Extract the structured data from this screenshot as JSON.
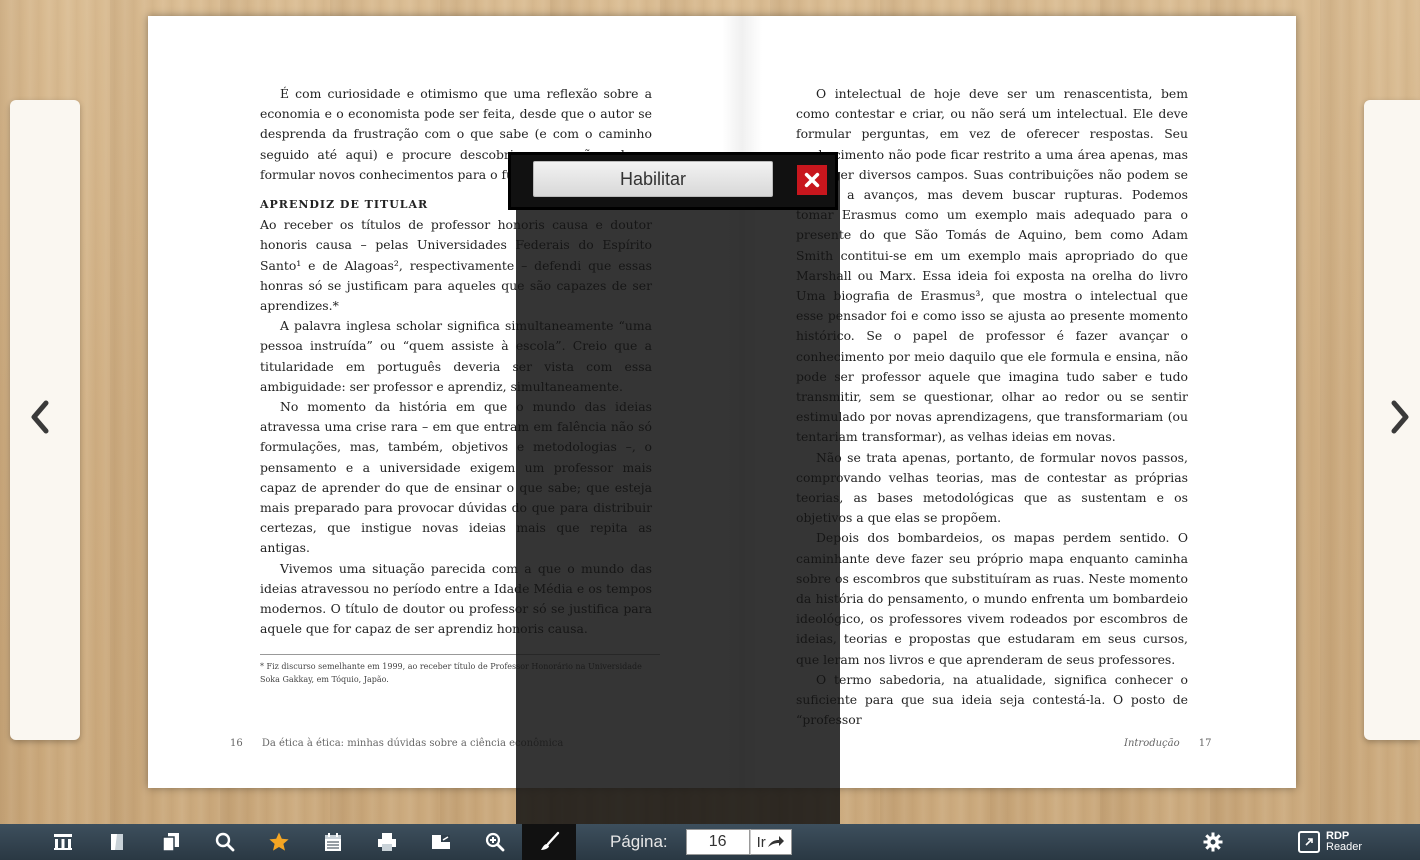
{
  "left_page": {
    "intro_paragraph": "É com curiosidade e otimismo que uma reflexão sobre a economia e o economista pode ser feita, desde que o autor se desprenda da frustração com o que sabe (e com o caminho seguido até aqui) e procure descobrir o que não sabe e formular novos conhecimentos para o futuro.",
    "section_heading": "Aprendiz de titular",
    "paragraphs": [
      "Ao receber os títulos de professor honoris causa e doutor honoris causa – pelas Universidades Federais do Espírito Santo¹ e de Alagoas², respectivamente – defendi que essas honras só se justificam para aqueles que são capazes de ser aprendizes.*",
      "A palavra inglesa scholar significa simultaneamente “uma pessoa instruída” ou “quem assiste à escola”. Creio que a titularidade em português deveria ser vista com essa ambiguidade: ser professor e aprendiz, simultaneamente.",
      "No momento da história em que o mundo das ideias atravessa uma crise rara – em que entram em falência não só formulações, mas, também, objetivos e metodologias –, o pensamento e a universidade exigem um professor mais capaz de aprender do que de ensinar o que sabe; que esteja mais preparado para provocar dúvidas do que para distribuir certezas, que instigue novas ideias mais que repita as antigas.",
      "Vivemos uma situação parecida com a que o mundo das ideias atravessou no período entre a Idade Média e os tempos modernos. O título de doutor ou professor só se justifica para aquele que for capaz de ser aprendiz honoris causa."
    ],
    "footnote": "*   Fiz discurso semelhante em 1999, ao receber título de Professor Honorário na Universidade Soka Gakkay, em Tóquio, Japão.",
    "folio_number": "16",
    "folio_title": "Da ética à ética: minhas dúvidas sobre a ciência econômica"
  },
  "right_page": {
    "paragraphs": [
      "O intelectual de hoje deve ser um renascentista, bem como contestar e criar, ou não será um intelectual. Ele deve formular perguntas, em vez de oferecer respostas. Seu conhecimento não pode ficar restrito a uma área apenas, mas abranger diversos campos. Suas contribuições não podem se limitar a avanços, mas devem buscar rupturas. Podemos tomar Erasmus como um exemplo mais adequado para o presente do que São Tomás de Aquino, bem como Adam Smith contitui-se em um exemplo mais apropriado do que Marshall ou Marx. Essa ideia foi exposta na orelha do livro Uma biografia de Erasmus³, que mostra o intelectual que esse pensador foi e como isso se ajusta ao presente momento histórico. Se o papel de professor é fazer avançar o conhecimento por meio daquilo que ele formula e ensina, não pode ser professor aquele que imagina tudo saber e tudo transmitir, sem se questionar, olhar ao redor ou se sentir estimulado por novas aprendizagens, que transformariam (ou tentariam transformar), as velhas ideias em novas.",
      "Não se trata apenas, portanto, de formular novos passos, comprovando velhas teorias, mas de contestar as próprias teorias, as bases metodológicas que as sustentam e os objetivos a que elas se propõem.",
      "Depois dos bombardeios, os mapas perdem sentido. O caminhante deve fazer seu próprio mapa enquanto caminha sobre os escombros que substituíram as ruas. Neste momento da história do pensamento, o mundo enfrenta um bombardeio ideológico, os professores vivem rodeados por escombros de ideias, teorias e propostas que estudaram em seus cursos, que leram nos livros e que aprenderam de seus professores.",
      "O termo sabedoria, na atualidade, significa conhecer o suficiente para que sua ideia seja contestá-la. O posto de “professor"
    ],
    "folio_title": "Introdução",
    "folio_number": "17"
  },
  "overlay": {
    "enable_label": "Habilitar"
  },
  "toolbar": {
    "buttons": [
      "grid-icon",
      "note-icon",
      "copy-icon",
      "search-icon",
      "star-icon",
      "calendar-icon",
      "print-icon",
      "fullscreen-icon",
      "zoom-icon",
      "brush-icon"
    ],
    "page_label": "Página:",
    "page_value": "16",
    "go_label": "Ir",
    "logo_line1": "RDP",
    "logo_line2": "Reader"
  },
  "colors": {
    "toolbar_bg": "#2f3e4a",
    "close_red": "#c8161d",
    "star": "#f5a623"
  }
}
